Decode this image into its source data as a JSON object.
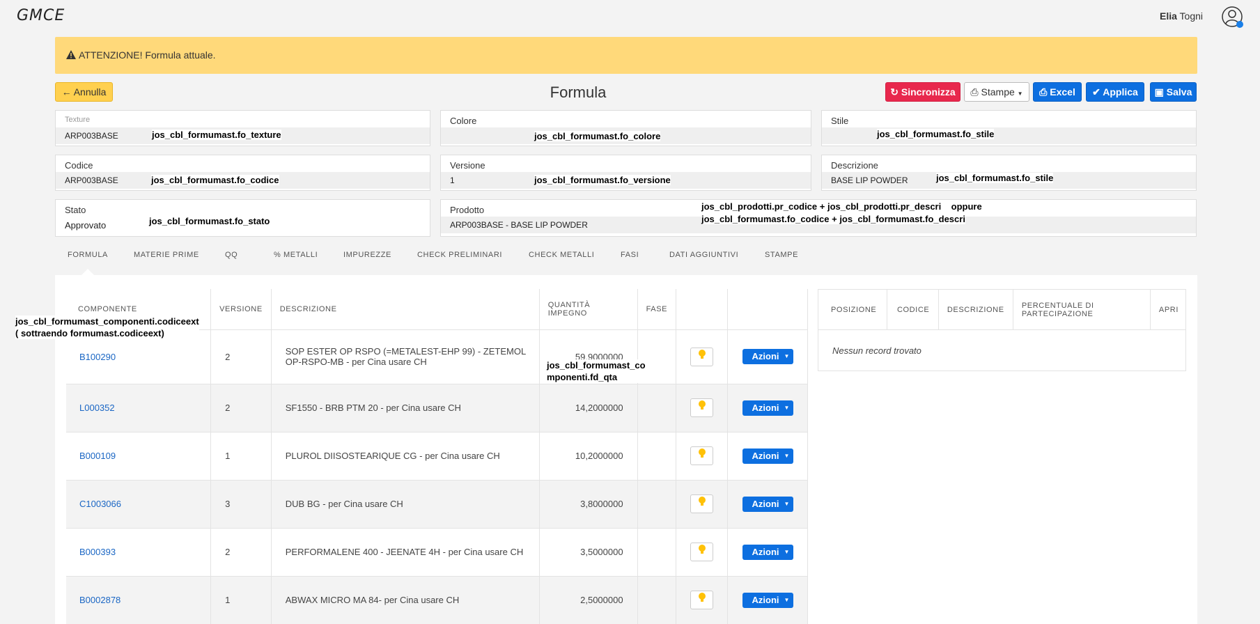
{
  "app": {
    "logo": "GMCE",
    "user_first": "Elia",
    "user_last": "Togni"
  },
  "alert": {
    "text": "ATTENZIONE! Formula attuale."
  },
  "header": {
    "back_label": "Annulla",
    "title": "Formula",
    "sync_label": "Sincronizza",
    "print_label": "Stampe",
    "excel_label": "Excel",
    "apply_label": "Applica",
    "save_label": "Salva"
  },
  "fields": {
    "texture": {
      "label": "Texture",
      "value": "ARP003BASE",
      "note": "jos_cbl_formumast.fo_texture"
    },
    "colore": {
      "label": "Colore",
      "value": "",
      "note": "jos_cbl_formumast.fo_colore"
    },
    "stile": {
      "label": "Stile",
      "value": "",
      "note": "jos_cbl_formumast.fo_stile"
    },
    "codice": {
      "label": "Codice",
      "value": "ARP003BASE",
      "note": "jos_cbl_formumast.fo_codice"
    },
    "versione": {
      "label": "Versione",
      "value": "1",
      "note": "jos_cbl_formumast.fo_versione"
    },
    "descrizione": {
      "label": "Descrizione",
      "value": "BASE LIP POWDER",
      "note": "jos_cbl_formumast.fo_stile"
    },
    "stato": {
      "label": "Stato",
      "value": "Approvato",
      "note": "jos_cbl_formumast.fo_stato"
    },
    "prodotto": {
      "label": "Prodotto",
      "value": "ARP003BASE - BASE LIP POWDER",
      "note_line1": "jos_cbl_prodotti.pr_codice + jos_cbl_prodotti.pr_descri    oppure",
      "note_line2": "jos_cbl_formumast.fo_codice + jos_cbl_formumast.fo_descri"
    }
  },
  "tabs": [
    "FORMULA",
    "MATERIE PRIME",
    "QQ",
    "% METALLI",
    "IMPUREZZE",
    "CHECK PRELIMINARI",
    "CHECK METALLI",
    "FASI",
    "DATI AGGIUNTIVI",
    "STAMPE"
  ],
  "components_table": {
    "headers": [
      "COMPONENTE",
      "VERSIONE",
      "DESCRIZIONE",
      "QUANTITÀ IMPEGNO",
      "FASE",
      "",
      ""
    ],
    "action_label": "Azioni",
    "rows": [
      {
        "code": "B100290",
        "version": "2",
        "description": "SOP ESTER OP RSPO (=METALEST-EHP 99) - ZETEMOL OP-RSPO-MB - per Cina usare CH",
        "qty": "59,9000000",
        "phase": ""
      },
      {
        "code": "L000352",
        "version": "2",
        "description": "SF1550 - BRB PTM 20 - per Cina usare CH",
        "qty": "14,2000000",
        "phase": ""
      },
      {
        "code": "B000109",
        "version": "1",
        "description": "PLUROL DIISOSTEARIQUE CG - per Cina usare CH",
        "qty": "10,2000000",
        "phase": ""
      },
      {
        "code": "C1003066",
        "version": "3",
        "description": "DUB BG - per Cina usare CH",
        "qty": "3,8000000",
        "phase": ""
      },
      {
        "code": "B000393",
        "version": "2",
        "description": "PERFORMALENE 400 - JEENATE 4H - per Cina usare CH",
        "qty": "3,5000000",
        "phase": ""
      },
      {
        "code": "B0002878",
        "version": "1",
        "description": "ABWAX MICRO MA 84- per Cina usare CH",
        "qty": "2,5000000",
        "phase": ""
      }
    ],
    "qty_note_line1": "jos_cbl_formumast_co",
    "qty_note_line2": "mponenti.fd_qta",
    "component_note_line1": "jos_cbl_formumast_componenti.codiceext",
    "component_note_line2": "( sottraendo formumast.codiceext)"
  },
  "side_table": {
    "headers": [
      "POSIZIONE",
      "CODICE",
      "DESCRIZIONE",
      "PERCENTUALE DI PARTECIPAZIONE",
      "APRI"
    ],
    "empty_text": "Nessun record trovato"
  }
}
